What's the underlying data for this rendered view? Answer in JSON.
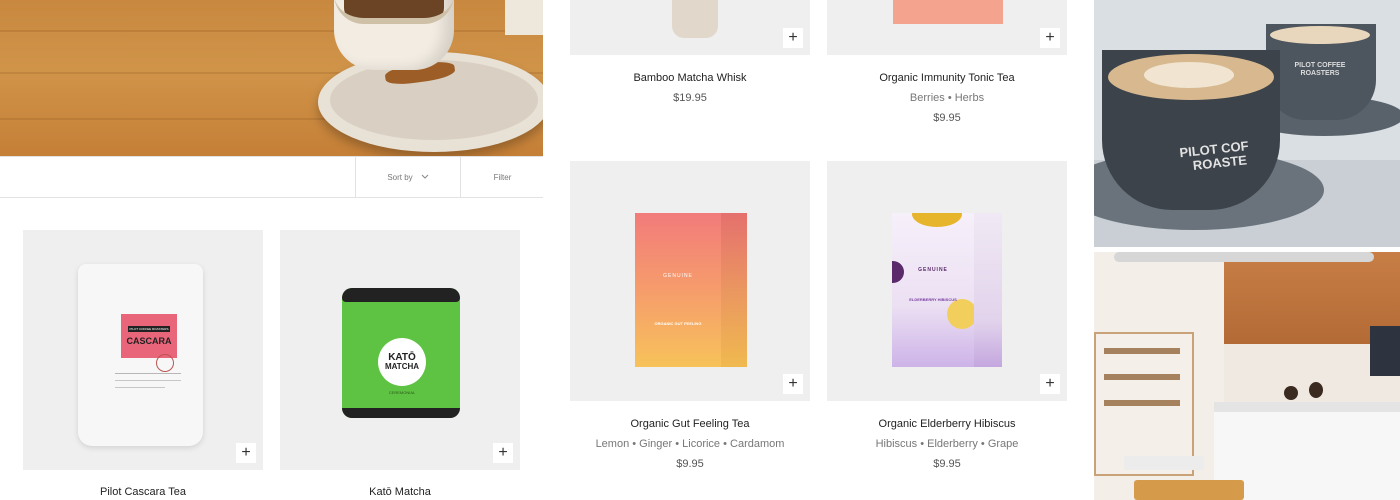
{
  "toolbar": {
    "sort_label": "Sort by",
    "filter_label": "Filter"
  },
  "products": [
    {
      "name": "Pilot Cascara Tea",
      "tags": "",
      "price": "",
      "package_brand": "PILOT COFFEE ROASTERS",
      "package_label": "CASCARA"
    },
    {
      "name": "Katō Matcha",
      "tags": "",
      "price": "",
      "package_label_line1": "KATŌ",
      "package_label_line2": "MATCHA",
      "package_sub": "CEREMONIAL"
    },
    {
      "name": "Bamboo Matcha Whisk",
      "tags": "",
      "price": "$19.95"
    },
    {
      "name": "Organic Immunity Tonic Tea",
      "tags": "Berries • Herbs",
      "price": "$9.95"
    },
    {
      "name": "Organic Gut Feeling Tea",
      "tags": "Lemon • Ginger • Licorice • Cardamom",
      "price": "$9.95",
      "package_brand": "GENUINE",
      "package_sub": "ORGANIC GUT FEELING"
    },
    {
      "name": "Organic Elderberry Hibiscus",
      "tags": "Hibiscus • Elderberry • Grape",
      "price": "$9.95",
      "package_brand": "GENUINE",
      "package_sub": "ELDERBERRY HIBISCUS"
    }
  ],
  "photos": {
    "cup_text_line1": "PILOT COF",
    "cup_text_line2": "ROASTE",
    "cup2_text_line1": "PILOT COFFEE",
    "cup2_text_line2": "ROASTERS"
  },
  "icons": {
    "add": "plus-icon",
    "sort": "chevron-down-icon"
  }
}
